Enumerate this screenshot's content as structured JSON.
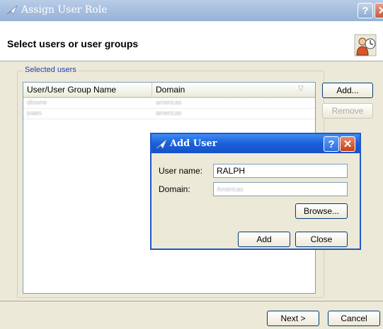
{
  "window": {
    "title": "Assign User Role",
    "help_label": "?",
    "close_label": "✕",
    "heading": "Select users or user groups"
  },
  "selected_users": {
    "group_label": "Selected users",
    "columns": [
      "User/User Group Name",
      "Domain"
    ],
    "rows": [
      {
        "name": "dlowne",
        "domain": "americas"
      },
      {
        "name": "jvaes",
        "domain": "americas"
      }
    ],
    "add_label": "Add...",
    "remove_label": "Remove"
  },
  "footer": {
    "next_label": "Next >",
    "cancel_label": "Cancel"
  },
  "add_user_dialog": {
    "title": "Add User",
    "help_label": "?",
    "close_label": "✕",
    "username_label": "User name:",
    "username_value": "RALPH",
    "domain_label": "Domain:",
    "domain_value": "Americas",
    "browse_label": "Browse...",
    "add_label": "Add",
    "close_button_label": "Close"
  }
}
